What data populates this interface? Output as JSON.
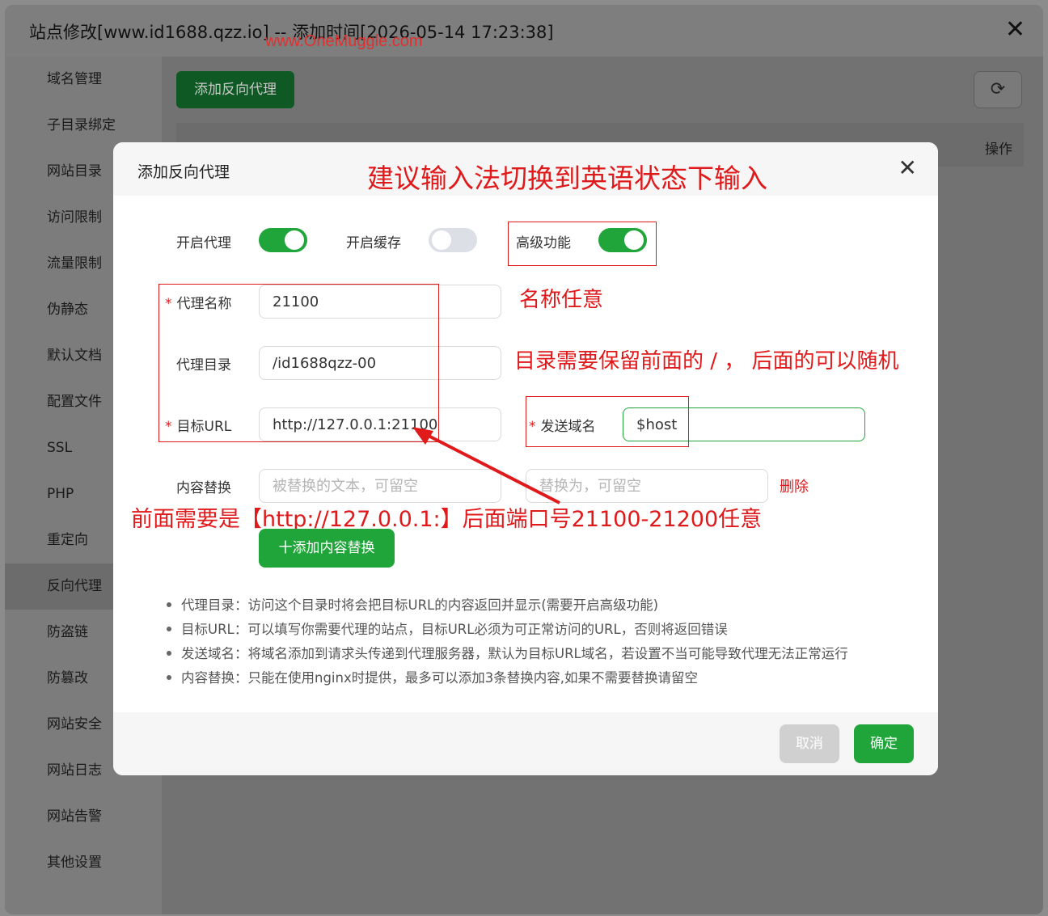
{
  "window": {
    "title": "站点修改[www.id1688.qzz.io] -- 添加时间[2026-05-14 17:23:38]",
    "close": "✕",
    "watermark": "www.OneMuggle.com"
  },
  "sidebar": {
    "items": [
      "域名管理",
      "子目录绑定",
      "网站目录",
      "访问限制",
      "流量限制",
      "伪静态",
      "默认文档",
      "配置文件",
      "SSL",
      "PHP",
      "重定向",
      "反向代理",
      "防盗链",
      "防篡改",
      "网站安全",
      "网站日志",
      "网站告警",
      "其他设置"
    ],
    "active_index": 11
  },
  "background": {
    "add_button": "添加反向代理",
    "refresh_icon": "⟳",
    "operation_header": "操作"
  },
  "modal": {
    "title": "添加反向代理",
    "close": "✕",
    "toggles": {
      "proxy_label": "开启代理",
      "proxy_on": true,
      "cache_label": "开启缓存",
      "cache_on": false,
      "advanced_label": "高级功能",
      "advanced_on": true
    },
    "fields": {
      "name_label": "代理名称",
      "name_value": "21100",
      "dir_label": "代理目录",
      "dir_value": "/id1688qzz-00",
      "url_label": "目标URL",
      "url_value": "http://127.0.0.1:21100",
      "domain_label": "发送域名",
      "domain_value": "$host",
      "replace_label": "内容替换",
      "replace_from_placeholder": "被替换的文本，可留空",
      "replace_to_placeholder": "替换为，可留空",
      "delete_link": "删除",
      "required_mark": "*"
    },
    "add_replace_button": "十添加内容替换",
    "tips": [
      "代理目录：访问这个目录时将会把目标URL的内容返回并显示(需要开启高级功能)",
      "目标URL：可以填写你需要代理的站点，目标URL必须为可正常访问的URL，否则将返回错误",
      "发送域名：将域名添加到请求头传递到代理服务器，默认为目标URL域名，若设置不当可能导致代理无法正常运行",
      "内容替换：只能在使用nginx时提供，最多可以添加3条替换内容,如果不需要替换请留空"
    ],
    "cancel_button": "取消",
    "confirm_button": "确定"
  },
  "annotations": {
    "ime_note": "建议输入法切换到英语状态下输入",
    "name_note": "名称任意",
    "dir_note": "目录需要保留前面的 / ， 后面的可以随机",
    "url_note": "前面需要是【http://127.0.0.1:】后面端口号21100-21200任意",
    "accent": "#e0191b"
  }
}
